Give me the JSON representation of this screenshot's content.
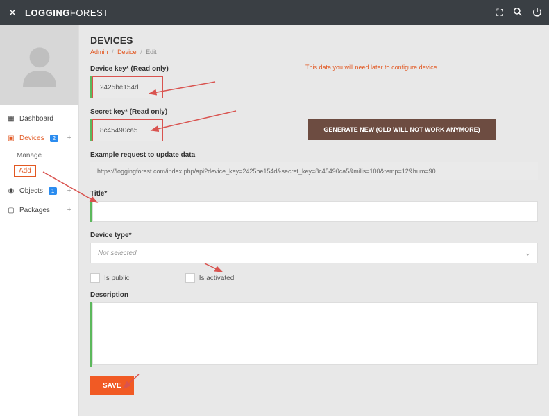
{
  "brand": {
    "strong": "LOGGING",
    "light": "FOREST"
  },
  "sidebar": {
    "dashboard": "Dashboard",
    "devices": {
      "label": "Devices",
      "badge": "2",
      "manage": "Manage",
      "add": "Add"
    },
    "objects": {
      "label": "Objects",
      "badge": "1"
    },
    "packages": "Packages"
  },
  "page": {
    "title": "DEVICES",
    "crumb_admin": "Admin",
    "crumb_device": "Device",
    "crumb_edit": "Edit"
  },
  "fields": {
    "device_key_label": "Device key* (Read only)",
    "device_key_value": "2425be154d",
    "secret_key_label": "Secret key* (Read only)",
    "secret_key_value": "8c45490ca5",
    "generate_btn": "GENERATE NEW (OLD WILL NOT WORK ANYMORE)",
    "example_label": "Example request to update data",
    "example_value": "https://loggingforest.com/index.php/api?device_key=2425be154d&secret_key=8c45490ca5&milis=100&temp=12&hum=90",
    "title_label": "Title*",
    "title_value": "",
    "device_type_label": "Device type*",
    "device_type_placeholder": "Not selected",
    "is_public": "Is public",
    "is_activated": "Is activated",
    "description_label": "Description",
    "description_value": "",
    "save_btn": "SAVE",
    "hint": "This data you will need later to configure device"
  }
}
